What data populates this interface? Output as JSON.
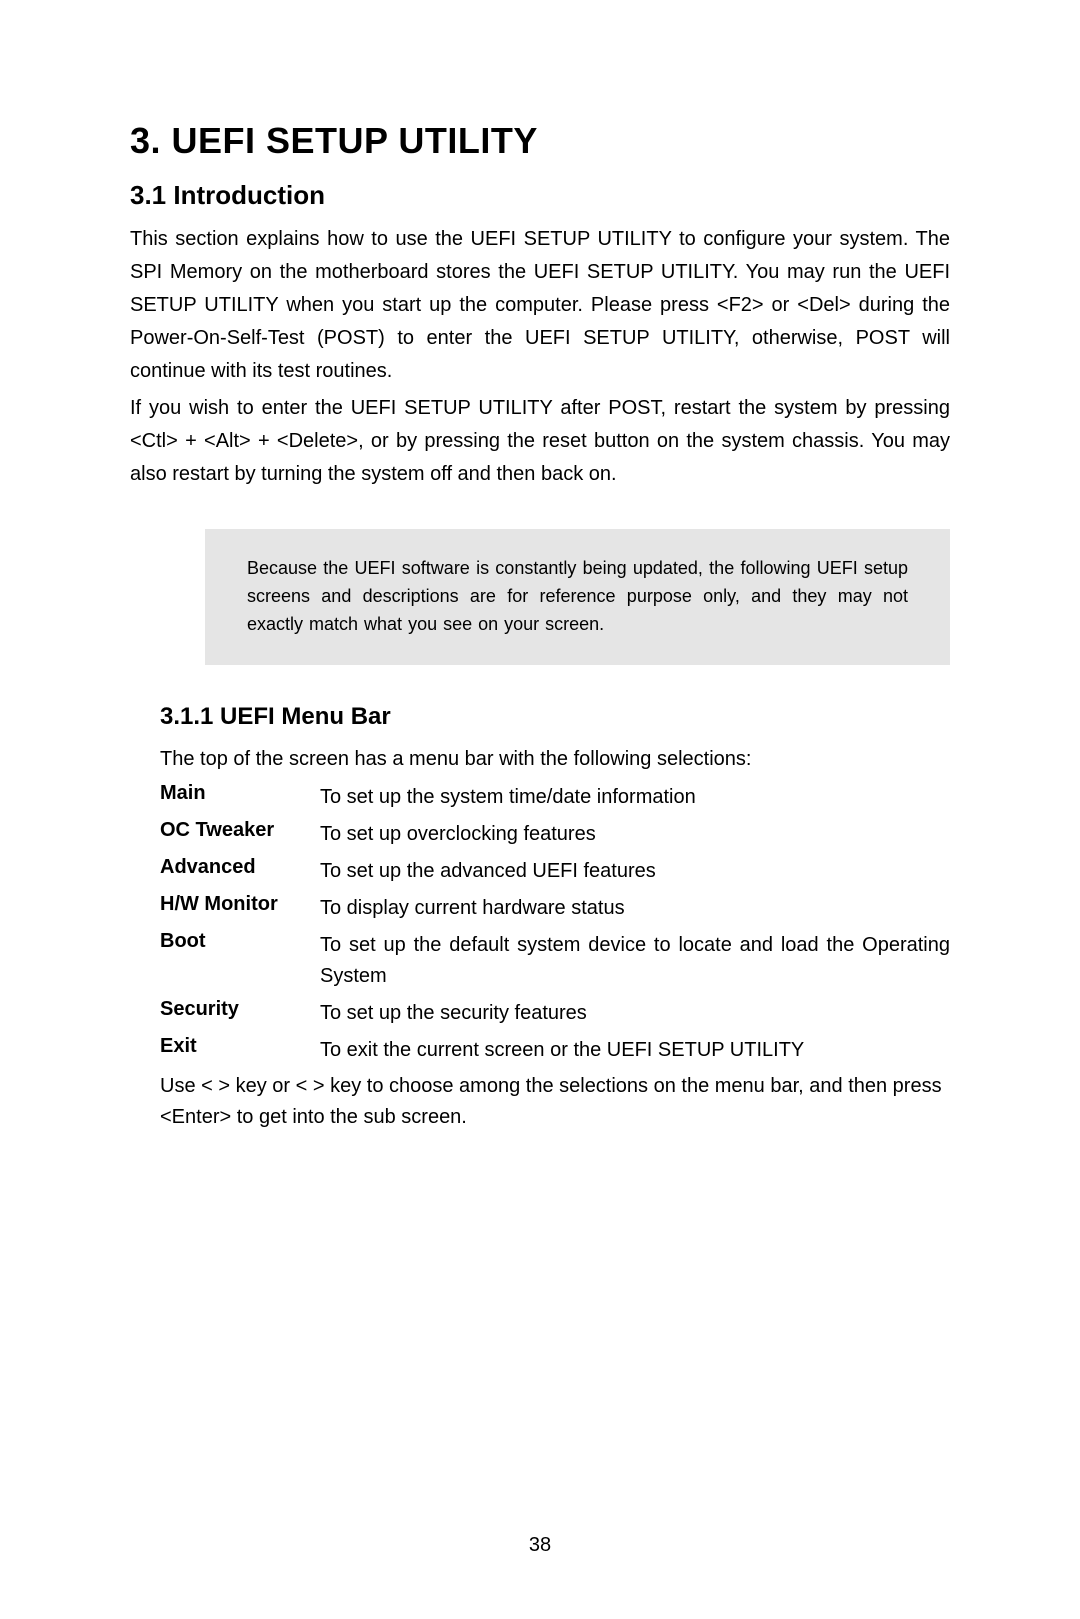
{
  "chapter": {
    "number_title": "3.  UEFI SETUP UTILITY"
  },
  "section": {
    "title": "3.1  Introduction",
    "p1": "This section explains how to use the UEFI SETUP UTILITY to configure your system. The SPI Memory on the motherboard stores the UEFI SETUP UTILITY. You may run the UEFI SETUP UTILITY when you start up the computer. Please press <F2> or <Del> during the Power-On-Self-Test (POST) to enter the UEFI SETUP UTILITY, otherwise, POST will continue with its test routines.",
    "p2": "If you wish to enter the UEFI SETUP UTILITY after POST, restart the system by pressing <Ctl> + <Alt> + <Delete>, or by pressing the reset button on the system chassis. You may also restart by turning the system off and then back on."
  },
  "notice": {
    "text": "Because the UEFI software is constantly being updated, the following UEFI setup screens and descriptions are for reference purpose only, and they may not exactly match what you see on your screen."
  },
  "subsection": {
    "title": "3.1.1  UEFI Menu Bar",
    "intro": "The top of the screen has a menu bar with the following selections:",
    "items": [
      {
        "label": "Main",
        "desc": "To set up the system time/date information"
      },
      {
        "label": "OC Tweaker",
        "desc": "To set up overclocking features"
      },
      {
        "label": "Advanced",
        "desc": "To set up the advanced UEFI features"
      },
      {
        "label": "H/W Monitor",
        "desc": "To display current hardware status"
      },
      {
        "label": "Boot",
        "desc": "To set up the default system device to locate and load the Operating System"
      },
      {
        "label": "Security",
        "desc": "To set up the security features"
      },
      {
        "label": "Exit",
        "desc": "To exit the current screen or the UEFI SETUP UTILITY"
      }
    ],
    "closing": "Use <      > key or <      > key to choose among the selections on the menu bar, and then press <Enter> to get into the sub screen."
  },
  "page_number": "38"
}
